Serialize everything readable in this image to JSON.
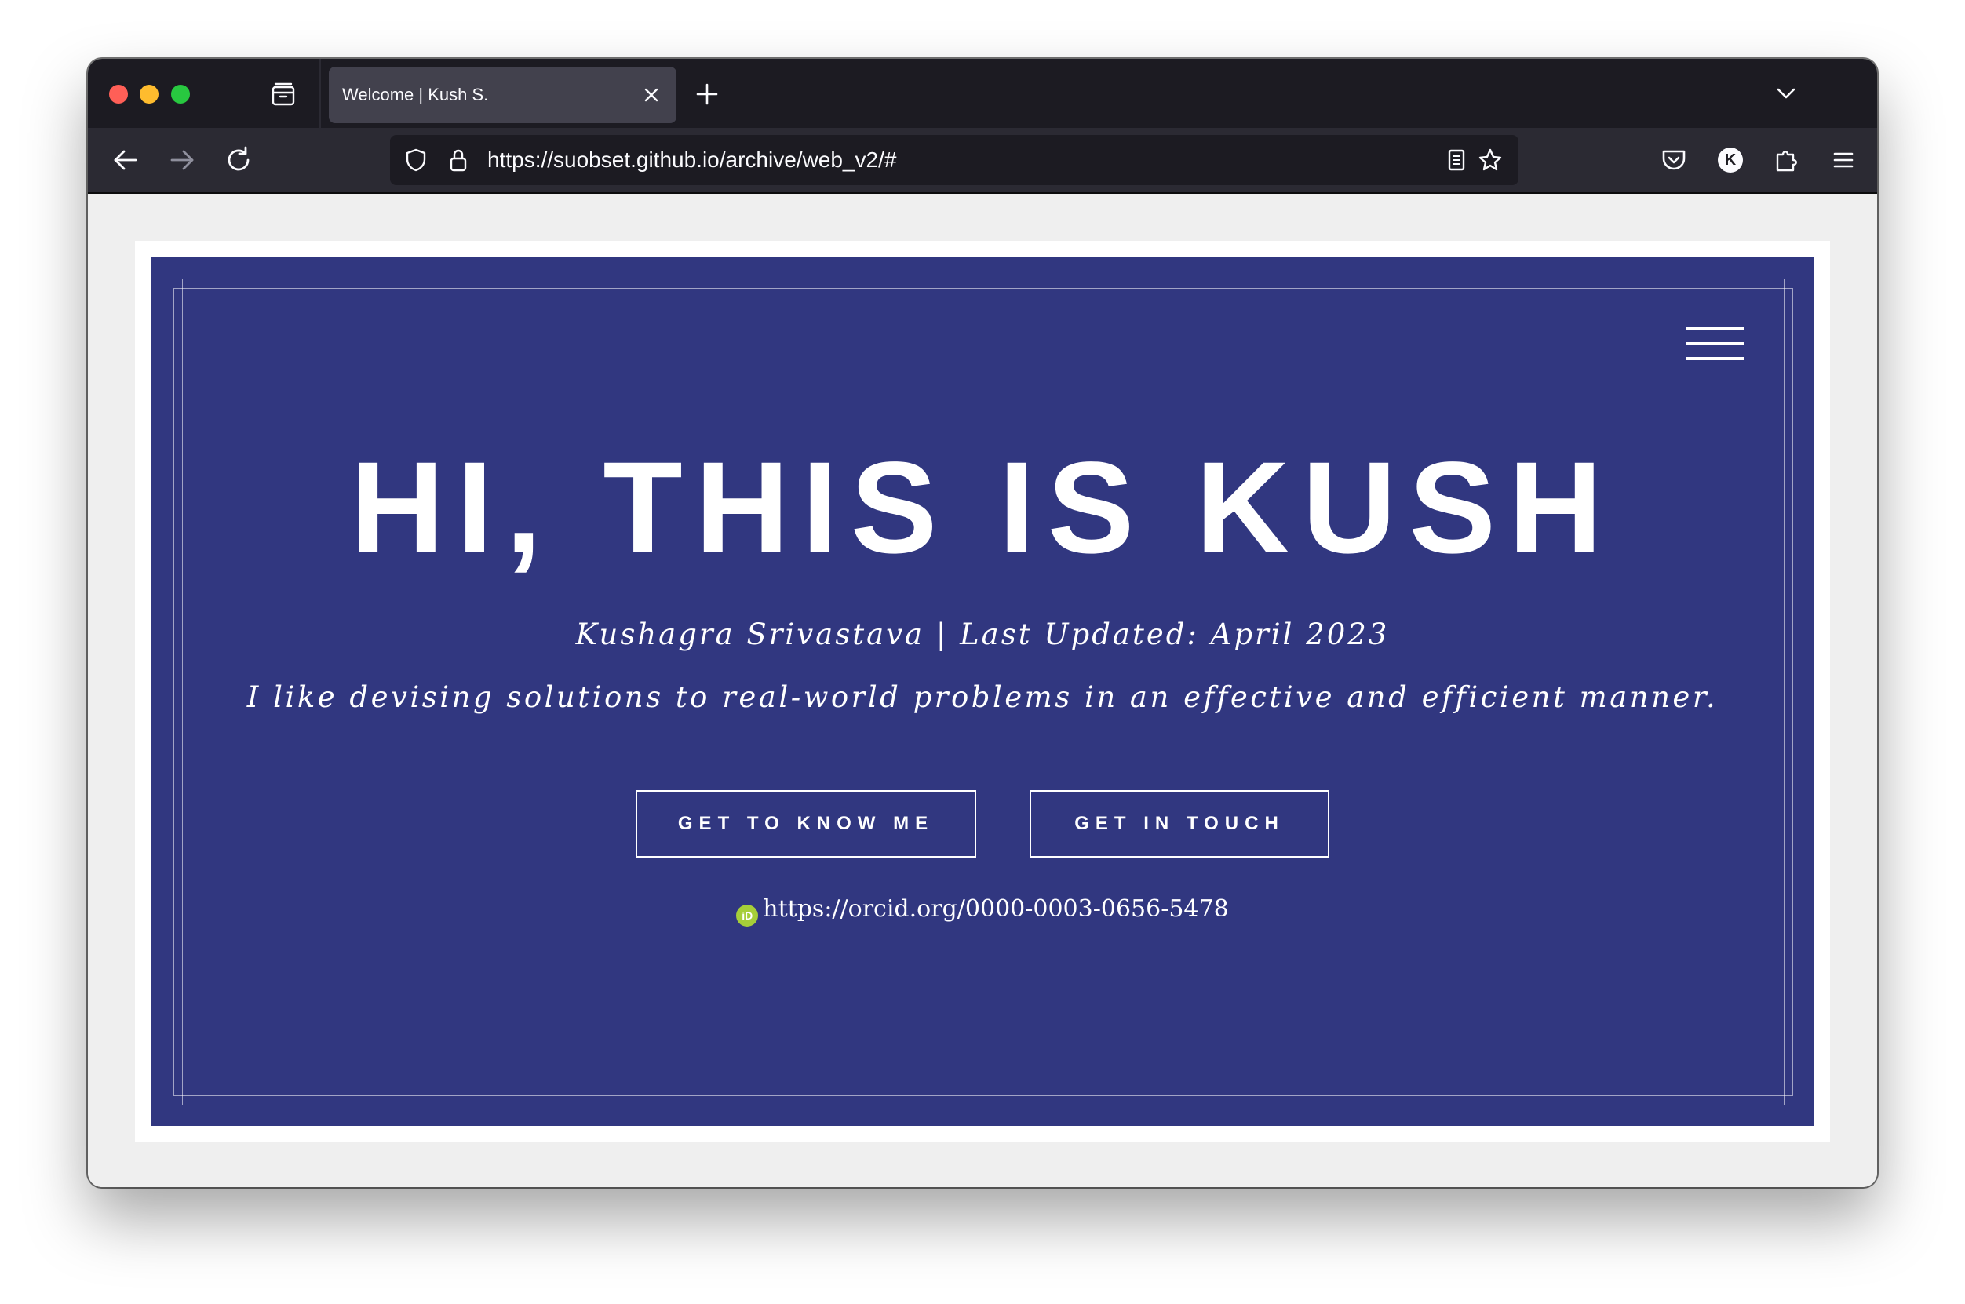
{
  "browser": {
    "tab": {
      "title": "Welcome | Kush S."
    },
    "url": "https://suobset.github.io/archive/web_v2/#",
    "account_initial": "K",
    "icons": {
      "tab_overview": "tab-overview-icon",
      "new_tab": "plus-icon",
      "tab_list": "chevron-down-icon",
      "back": "arrow-left-icon",
      "forward": "arrow-right-icon",
      "reload": "reload-icon",
      "tracking": "shield-icon",
      "secure": "lock-icon",
      "reader": "reader-view-icon",
      "bookmark": "star-icon",
      "pocket": "pocket-icon",
      "extensions": "puzzle-icon",
      "menu": "hamburger-menu-icon"
    }
  },
  "page": {
    "headline": "HI, THIS IS KUSH",
    "byline": "Kushagra Srivastava | Last Updated: April 2023",
    "tagline": "I like devising solutions to real-world problems in an effective and efficient manner.",
    "buttons": {
      "know": "GET TO KNOW ME",
      "touch": "GET IN TOUCH"
    },
    "orcid": {
      "badge": "iD",
      "link": "https://orcid.org/0000-0003-0656-5478"
    },
    "colors": {
      "hero_background": "#313780",
      "orcid_green": "#a6ce39"
    }
  }
}
